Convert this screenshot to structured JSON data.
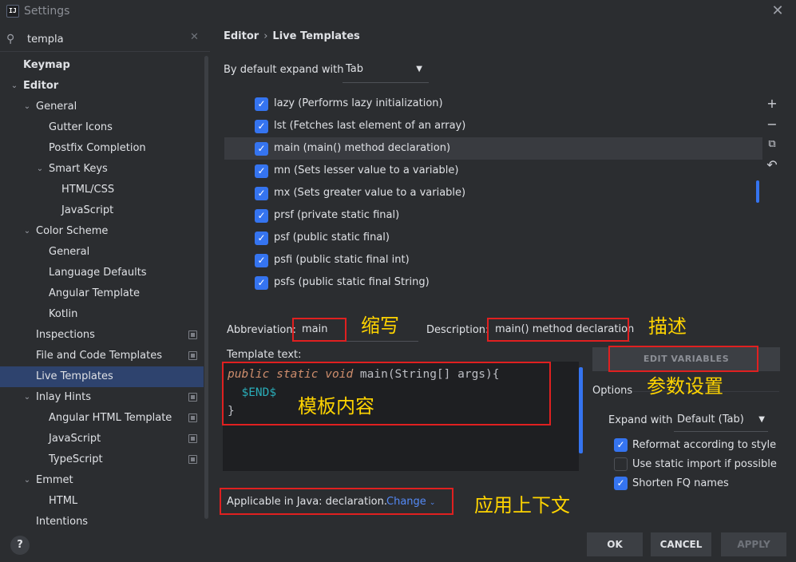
{
  "window": {
    "title": "Settings",
    "logo_text": "IJ"
  },
  "sidebar": {
    "search_value": "templa",
    "items": [
      {
        "label": "Keymap",
        "level": 0,
        "bold": true,
        "chevron": "",
        "scope": false
      },
      {
        "label": "Editor",
        "level": 0,
        "bold": true,
        "chevron": "down",
        "scope": false
      },
      {
        "label": "General",
        "level": 1,
        "chevron": "down",
        "scope": false
      },
      {
        "label": "Gutter Icons",
        "level": 2,
        "chevron": "",
        "scope": false
      },
      {
        "label": "Postfix Completion",
        "level": 2,
        "chevron": "",
        "scope": false
      },
      {
        "label": "Smart Keys",
        "level": 2,
        "chevron": "down",
        "scope": false
      },
      {
        "label": "HTML/CSS",
        "level": 3,
        "chevron": "",
        "scope": false
      },
      {
        "label": "JavaScript",
        "level": 3,
        "chevron": "",
        "scope": false
      },
      {
        "label": "Color Scheme",
        "level": 1,
        "chevron": "down",
        "scope": false
      },
      {
        "label": "General",
        "level": 2,
        "chevron": "",
        "scope": false
      },
      {
        "label": "Language Defaults",
        "level": 2,
        "chevron": "",
        "scope": false
      },
      {
        "label": "Angular Template",
        "level": 2,
        "chevron": "",
        "scope": false
      },
      {
        "label": "Kotlin",
        "level": 2,
        "chevron": "",
        "scope": false
      },
      {
        "label": "Inspections",
        "level": 1,
        "chevron": "",
        "scope": true
      },
      {
        "label": "File and Code Templates",
        "level": 1,
        "chevron": "",
        "scope": true
      },
      {
        "label": "Live Templates",
        "level": 1,
        "chevron": "",
        "scope": false,
        "selected": true
      },
      {
        "label": "Inlay Hints",
        "level": 1,
        "chevron": "down",
        "scope": true
      },
      {
        "label": "Angular HTML Template",
        "level": 2,
        "chevron": "",
        "scope": true
      },
      {
        "label": "JavaScript",
        "level": 2,
        "chevron": "",
        "scope": true
      },
      {
        "label": "TypeScript",
        "level": 2,
        "chevron": "",
        "scope": true
      },
      {
        "label": "Emmet",
        "level": 1,
        "chevron": "down",
        "scope": false
      },
      {
        "label": "HTML",
        "level": 2,
        "chevron": "",
        "scope": false
      },
      {
        "label": "Intentions",
        "level": 1,
        "chevron": "",
        "scope": false
      }
    ],
    "help_label": "?"
  },
  "main": {
    "breadcrumb": {
      "parent": "Editor",
      "current": "Live Templates",
      "separator": "›"
    },
    "expand_label": "By default expand with",
    "expand_value": "Tab",
    "templates": [
      {
        "label": "lazy (Performs lazy initialization)",
        "checked": true
      },
      {
        "label": "lst (Fetches last element of an array)",
        "checked": true
      },
      {
        "label": "main (main() method declaration)",
        "checked": true,
        "selected": true
      },
      {
        "label": "mn (Sets lesser value to a variable)",
        "checked": true
      },
      {
        "label": "mx (Sets greater value to a variable)",
        "checked": true
      },
      {
        "label": "prsf (private static final)",
        "checked": true
      },
      {
        "label": "psf (public static final)",
        "checked": true
      },
      {
        "label": "psfi (public static final int)",
        "checked": true
      },
      {
        "label": "psfs (public static final String)",
        "checked": true
      }
    ],
    "side_tools": [
      "+",
      "−",
      "⧉",
      "↶"
    ],
    "abbreviation_label": "Abbreviation:",
    "abbreviation_value": "main",
    "description_label": "Description:",
    "description_value": "main() method declaration",
    "template_text_label": "Template text:",
    "code": {
      "kw1": "public",
      "kw2": "static",
      "kw3": "void",
      "sig": " main(String[] args){",
      "end_var": "$END$",
      "close": "}"
    },
    "edit_variables_label": "EDIT VARIABLES",
    "options_label": "Options",
    "expand_with_label": "Expand with",
    "expand_with_value": "Default (Tab)",
    "options": [
      {
        "label": "Reformat according to style",
        "checked": true
      },
      {
        "label": "Use static import if possible",
        "checked": false
      },
      {
        "label": "Shorten FQ names",
        "checked": true
      }
    ],
    "context_text": "Applicable in Java: declaration.",
    "change_link": "Change",
    "buttons": {
      "ok": "OK",
      "cancel": "CANCEL",
      "apply": "APPLY"
    }
  },
  "annotations": {
    "abbreviation": "缩写",
    "description": "描述",
    "variables": "参数设置",
    "template_content": "模板内容",
    "context": "应用上下文"
  },
  "colors": {
    "accent": "#3574f0",
    "annotation_box": "#e02020",
    "annotation_text": "#ffd400"
  }
}
